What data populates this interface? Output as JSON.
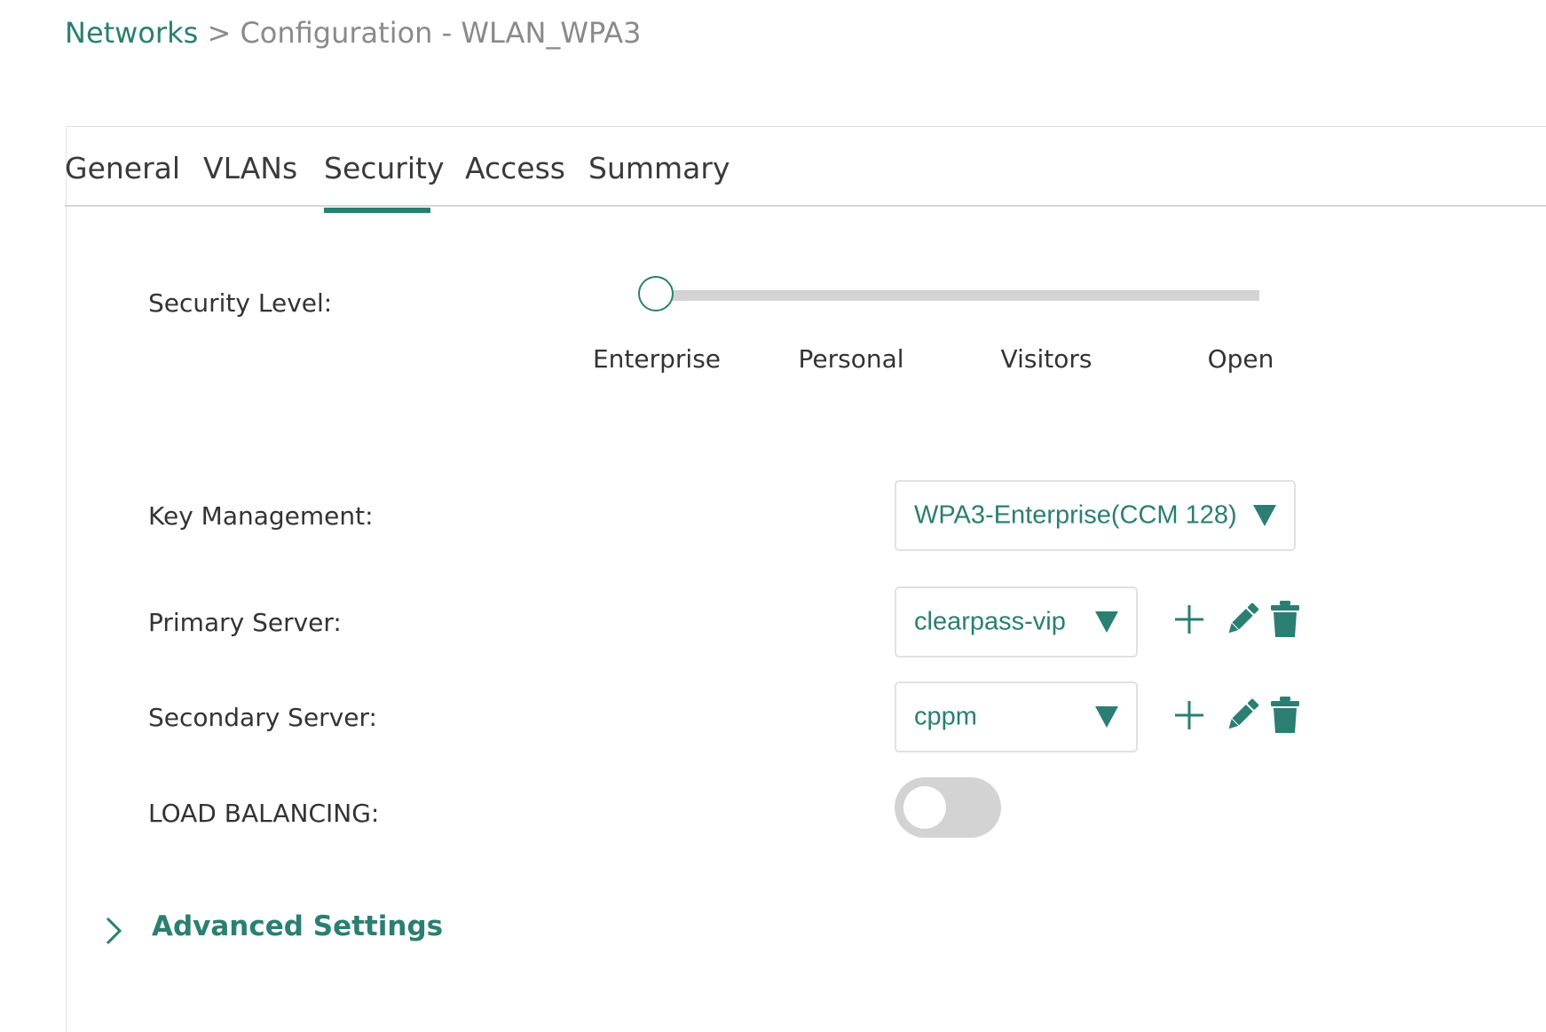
{
  "breadcrumb": {
    "root": "Networks",
    "separator": ">",
    "current": "Configuration - WLAN_WPA3"
  },
  "tabs": [
    {
      "label": "General"
    },
    {
      "label": "VLANs"
    },
    {
      "label": "Security",
      "active": true
    },
    {
      "label": "Access"
    },
    {
      "label": "Summary"
    }
  ],
  "security_level": {
    "label": "Security Level:",
    "selected": "Enterprise",
    "stops": [
      "Enterprise",
      "Personal",
      "Visitors",
      "Open"
    ]
  },
  "key_management": {
    "label": "Key Management:",
    "value": "WPA3-Enterprise(CCM 128)"
  },
  "primary_server": {
    "label": "Primary Server:",
    "value": "clearpass-vip"
  },
  "secondary_server": {
    "label": "Secondary Server:",
    "value": "cppm"
  },
  "load_balancing": {
    "label": "LOAD BALANCING:",
    "enabled": false
  },
  "advanced_settings": {
    "label": "Advanced Settings",
    "expanded": false
  },
  "icons": {
    "add": "plus-icon",
    "edit": "pencil-icon",
    "delete": "trash-icon",
    "expand": "chevron-right-icon",
    "dropdown": "caret-down-icon"
  },
  "colors": {
    "accent": "#2a7f72",
    "track": "#d3d3d3",
    "text": "#333333",
    "muted": "#8a8a8a"
  }
}
